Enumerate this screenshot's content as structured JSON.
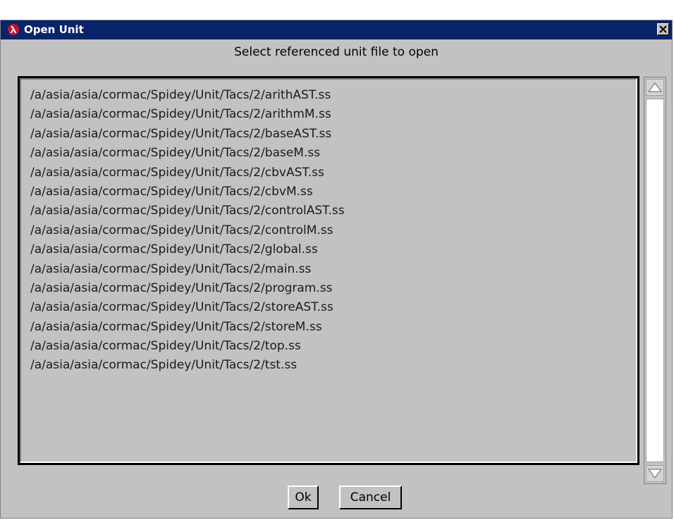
{
  "window": {
    "title": "Open Unit",
    "icon": "plt-lambda-icon",
    "close_glyph": "✕",
    "titlebar_color": "#0a246a"
  },
  "prompt": "Select referenced unit file to open",
  "files": [
    "/a/asia/asia/cormac/Spidey/Unit/Tacs/2/arithAST.ss",
    "/a/asia/asia/cormac/Spidey/Unit/Tacs/2/arithmM.ss",
    "/a/asia/asia/cormac/Spidey/Unit/Tacs/2/baseAST.ss",
    "/a/asia/asia/cormac/Spidey/Unit/Tacs/2/baseM.ss",
    "/a/asia/asia/cormac/Spidey/Unit/Tacs/2/cbvAST.ss",
    "/a/asia/asia/cormac/Spidey/Unit/Tacs/2/cbvM.ss",
    "/a/asia/asia/cormac/Spidey/Unit/Tacs/2/controlAST.ss",
    "/a/asia/asia/cormac/Spidey/Unit/Tacs/2/controlM.ss",
    "/a/asia/asia/cormac/Spidey/Unit/Tacs/2/global.ss",
    "/a/asia/asia/cormac/Spidey/Unit/Tacs/2/main.ss",
    "/a/asia/asia/cormac/Spidey/Unit/Tacs/2/program.ss",
    "/a/asia/asia/cormac/Spidey/Unit/Tacs/2/storeAST.ss",
    "/a/asia/asia/cormac/Spidey/Unit/Tacs/2/storeM.ss",
    "/a/asia/asia/cormac/Spidey/Unit/Tacs/2/top.ss",
    "/a/asia/asia/cormac/Spidey/Unit/Tacs/2/tst.ss"
  ],
  "buttons": {
    "ok_label": "Ok",
    "cancel_label": "Cancel"
  }
}
